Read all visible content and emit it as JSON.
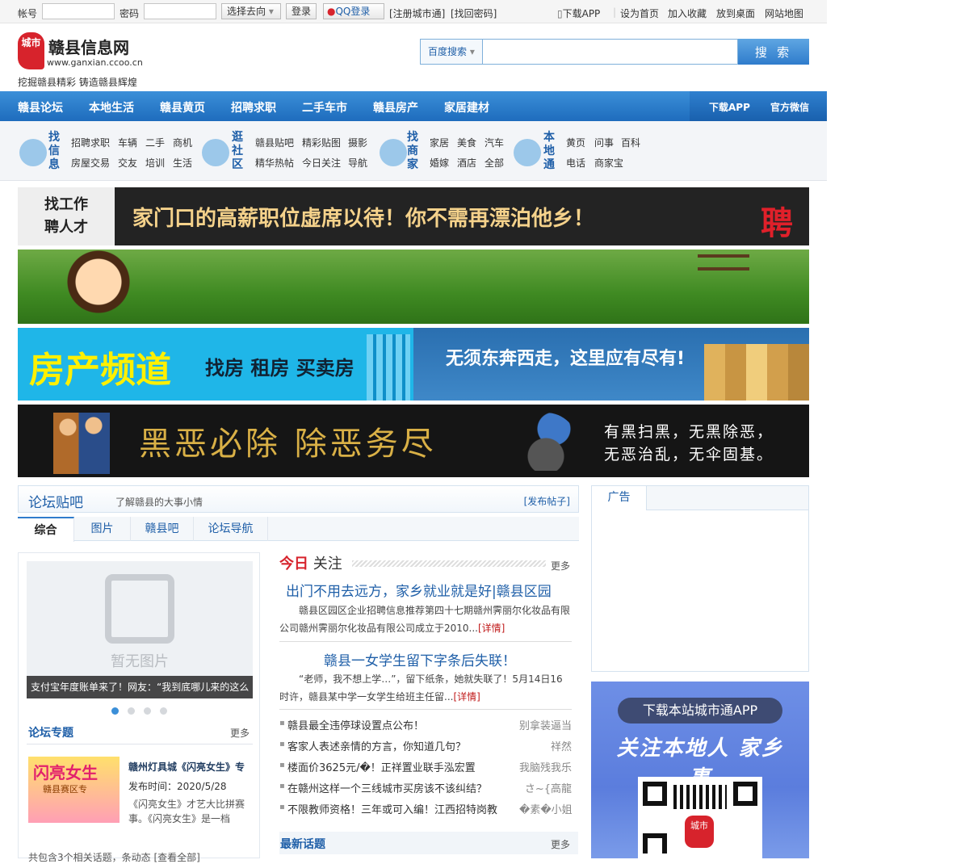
{
  "topbar": {
    "account_label": "帐号",
    "password_label": "密码",
    "choose_dest": "选择去向",
    "login": "登录",
    "qq_login": "QQ登录",
    "register": "[注册城市通]",
    "find_password": "[找回密码]",
    "download_app": "下载APP",
    "set_home": "设为首页",
    "add_fav": "加入收藏",
    "put_desktop": "放到桌面",
    "sitemap": "网站地图",
    "separator": "|"
  },
  "header": {
    "logo_mark": "城市",
    "site_name": "赣县信息网",
    "site_url": "www.ganxian.ccoo.cn",
    "slogan": "挖掘赣县精彩 铸造赣县辉煌",
    "search_engine": "百度搜索",
    "search_button": "搜 索"
  },
  "nav": {
    "items": [
      "赣县论坛",
      "本地生活",
      "赣县黄页",
      "招聘求职",
      "二手车市",
      "赣县房产",
      "家居建材"
    ],
    "right": [
      "下载APP",
      "官方微信"
    ]
  },
  "subnav": {
    "groups": [
      {
        "title": "找信息",
        "links": [
          "招聘求职",
          "车辆",
          "二手",
          "商机",
          "房屋交易",
          "交友",
          "培训",
          "生活"
        ]
      },
      {
        "title": "逛社区",
        "links": [
          "赣县贴吧",
          "精彩贴图",
          "摄影",
          "精华热帖",
          "今日关注",
          "导航"
        ]
      },
      {
        "title": "找商家",
        "links": [
          "家居",
          "美食",
          "汽车",
          "婚嫁",
          "酒店",
          "全部"
        ]
      },
      {
        "title": "本地通",
        "links": [
          "黄页",
          "问事",
          "百科",
          "电话",
          "商家宝"
        ]
      }
    ]
  },
  "banners": {
    "b1_tag": [
      "找工作",
      "聘人才"
    ],
    "b1_text": "家门口的高薪职位虚席以待！你不需再漂泊他乡！",
    "b1_char": "聘",
    "b3_big": "房产频道",
    "b3_mid": "找房 租房 买卖房",
    "b3_right": "无须东奔西走，这里应有尽有!",
    "b4_big": "黑恶必除 除恶务尽",
    "b4_right": [
      "有黑扫黑，无黑除恶，",
      "无恶治乱，无伞固基。"
    ]
  },
  "forum": {
    "title": "论坛贴吧",
    "subtitle": "了解赣县的大事小情",
    "post": "[发布帖子]",
    "tabs": [
      "综合",
      "图片",
      "赣县吧",
      "论坛导航"
    ]
  },
  "left": {
    "no_image": "暂无图片",
    "caption": "支付宝年度账单来了！网友：“我到底哪儿来的这么",
    "topic_title": "论坛专题",
    "more": "更多",
    "topic_image_title": "闪亮女生",
    "topic_image_sub": "赣县赛区专",
    "topic_name": "赣州灯具城《闪亮女生》专",
    "topic_date": "发布时间：2020/5/28",
    "topic_desc": "《闪亮女生》才艺大比拼赛事。《闪亮女生》是一档",
    "count_text": "共包含3个相关话题，条动态 [查看全部]"
  },
  "today": {
    "title_red": "今日",
    "title": "关注",
    "more": "更多",
    "headlines": [
      {
        "title": "出门不用去远方，家乡就业就是好|赣县区园",
        "desc": "赣县区园区企业招聘信息推荐第四十七期赣州霁丽尔化妆品有限公司赣州霁丽尔化妆品有限公司成立于2010...",
        "detail": "[详情]"
      },
      {
        "title": "赣县一女学生留下字条后失联！",
        "desc": "“老师，我不想上学…”，留下纸条，她就失联了！5月14日16时许，赣县某中学一女学生给班主任留...",
        "detail": "[详情]"
      }
    ],
    "list": [
      {
        "title": "赣县最全违停球设置点公布！",
        "author": "别拿装逼当"
      },
      {
        "title": "客家人表述亲情的方言，你知道几句？",
        "author": "祥然"
      },
      {
        "title": "楼面价3625元/�！正祥置业联手泓宏置",
        "author": "我脑残我乐"
      },
      {
        "title": "在赣州这样一个三线城市买房该不该纠结？",
        "author": "さ~{高龍"
      },
      {
        "title": "不限教师资格！三年或可入编！江西招特岗教",
        "author": "�素�小姐"
      }
    ],
    "new_title": "最新话题",
    "new_more": "更多"
  },
  "ad": {
    "title": "广告",
    "app_pill": "下载本站城市通APP",
    "app_slogan": "关注本地人 家乡事",
    "qr_mark": "城市"
  }
}
